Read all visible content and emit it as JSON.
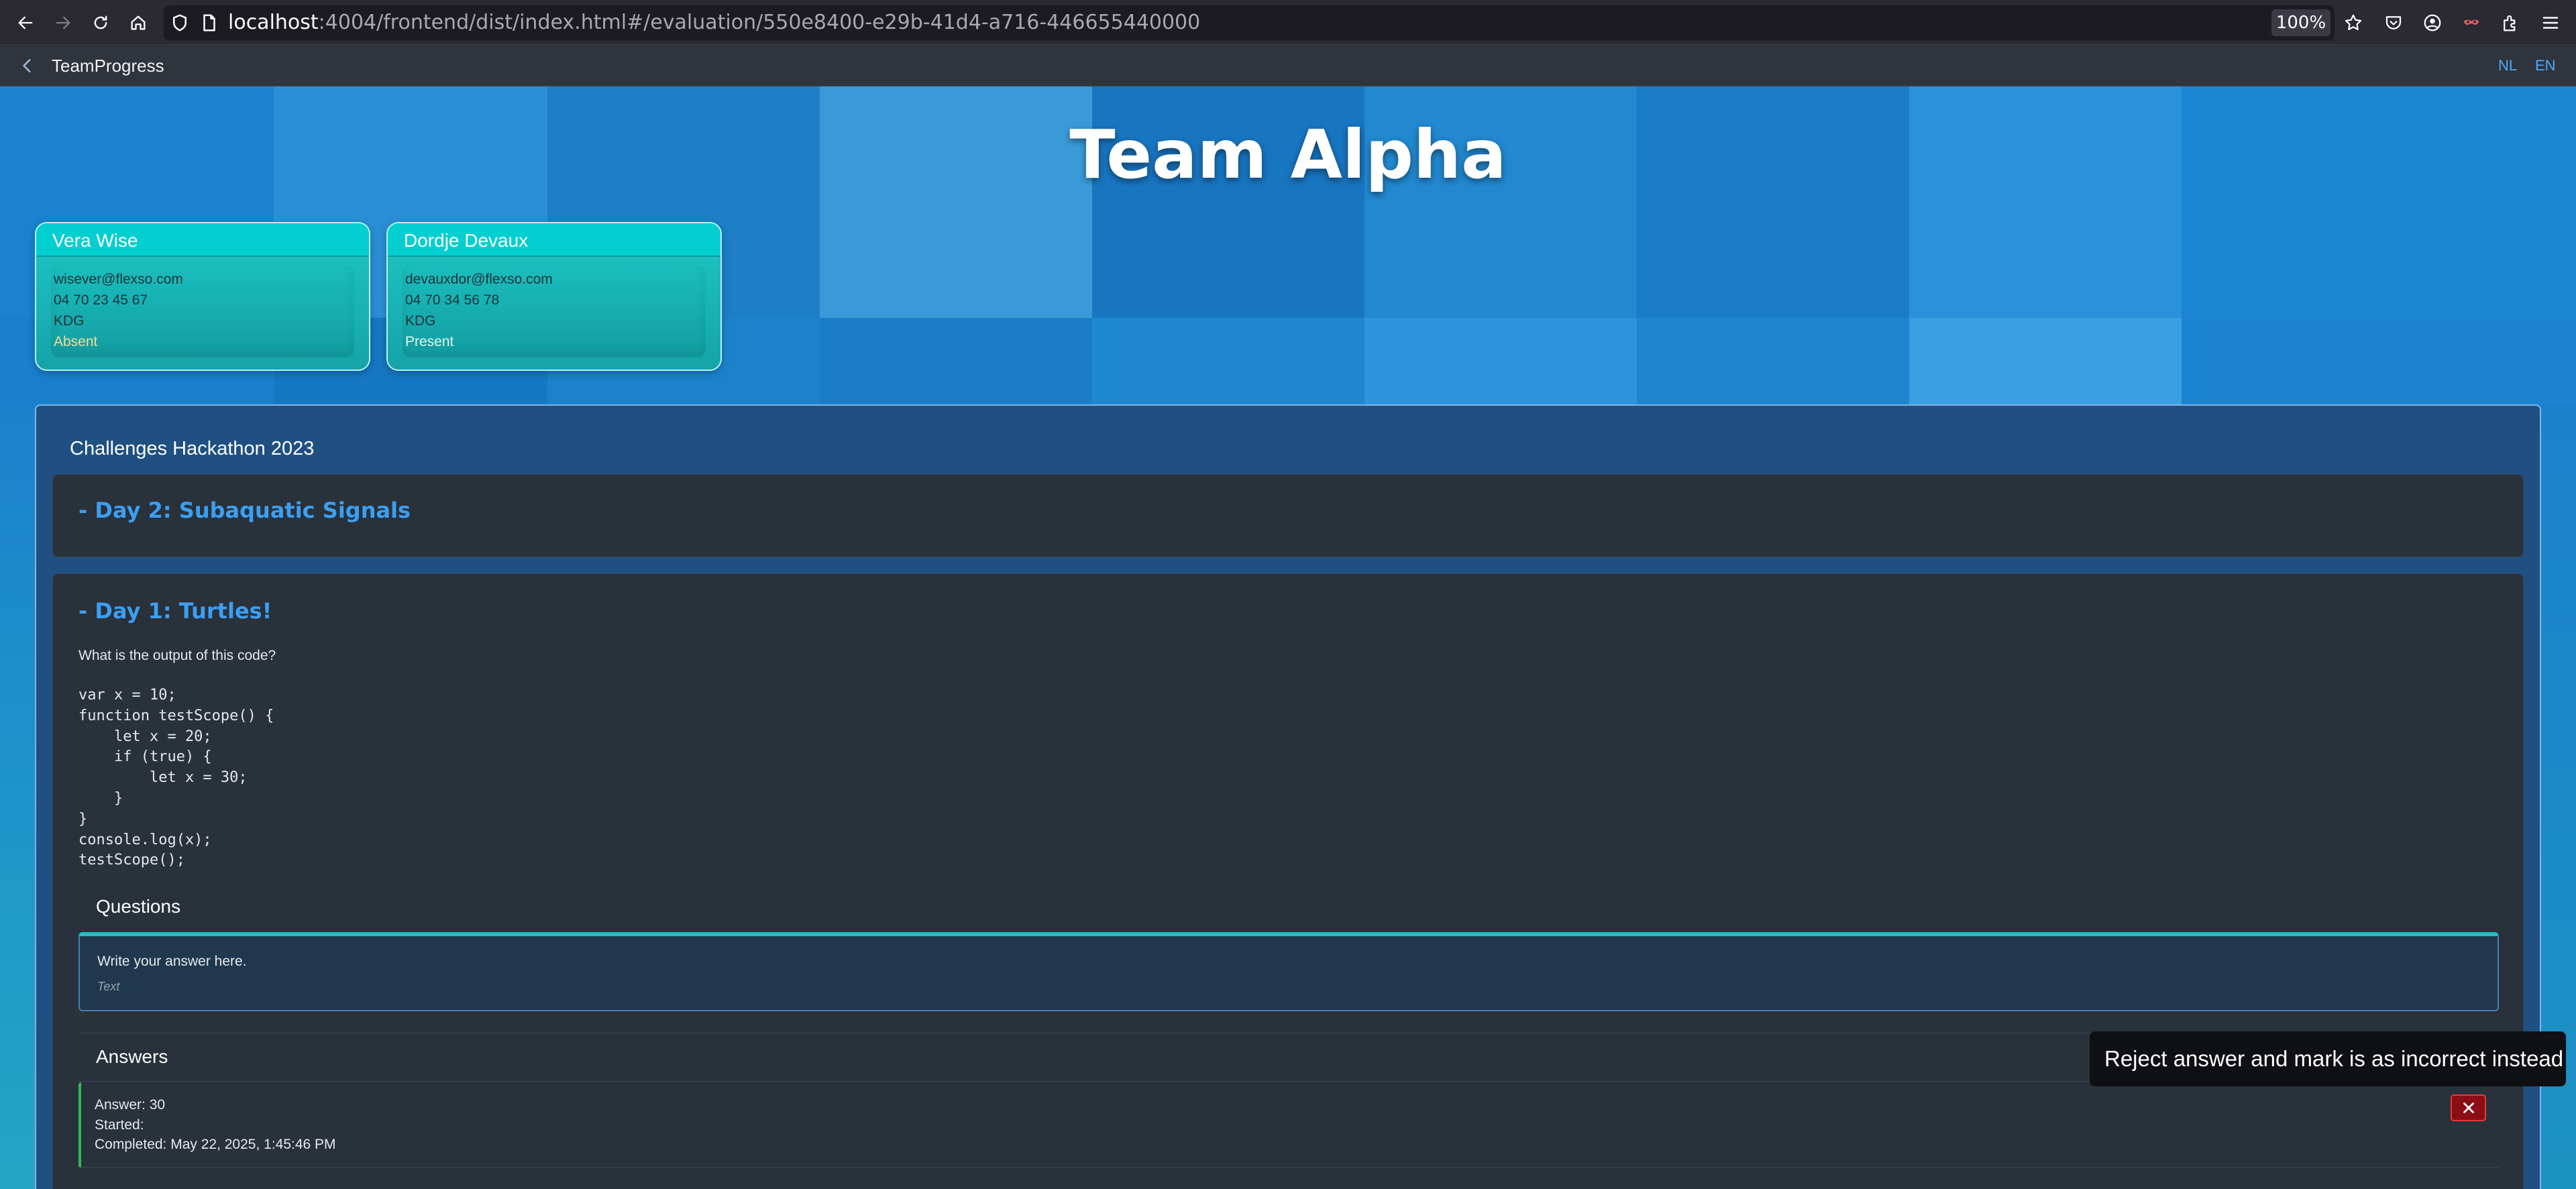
{
  "browser": {
    "url_host": "localhost",
    "url_rest": ":4004/frontend/dist/index.html#/evaluation/550e8400-e29b-41d4-a716-446655440000",
    "zoom": "100%"
  },
  "shell": {
    "title": "TeamProgress",
    "lang_nl": "NL",
    "lang_en": "EN"
  },
  "team": {
    "name": "Team Alpha"
  },
  "members": [
    {
      "name": "Vera Wise",
      "email": "wisever@flexso.com",
      "phone": "04 70 23 45 67",
      "org": "KDG",
      "status": "Absent"
    },
    {
      "name": "Dordje Devaux",
      "email": "devauxdor@flexso.com",
      "phone": "04 70 34 56 78",
      "org": "KDG",
      "status": "Present"
    }
  ],
  "challenges": {
    "title": "Challenges Hackathon 2023",
    "days": [
      {
        "title": "- Day 2: Subaquatic Signals"
      },
      {
        "title": "- Day 1: Turtles!",
        "question": "What is the output of this code?",
        "code": "var x = 10;\nfunction testScope() {\n    let x = 20;\n    if (true) {\n        let x = 30;\n    }\n}\nconsole.log(x);\ntestScope();",
        "questions_label": "Questions",
        "answer_placeholder": "Write your answer here.",
        "answer_type": "Text",
        "answers_label": "Answers",
        "answers": [
          {
            "answer": "Answer: 30",
            "started": "Started:",
            "completed": "Completed: May 22, 2025, 1:45:46 PM"
          }
        ]
      }
    ]
  },
  "tooltip": {
    "text": "Reject answer and mark is as incorrect instead"
  },
  "colors": {
    "accent": "#3b9ff2",
    "card_teal": "#03cfd0",
    "reject": "#8b0d15",
    "answer_ok": "#2dbb5c"
  }
}
